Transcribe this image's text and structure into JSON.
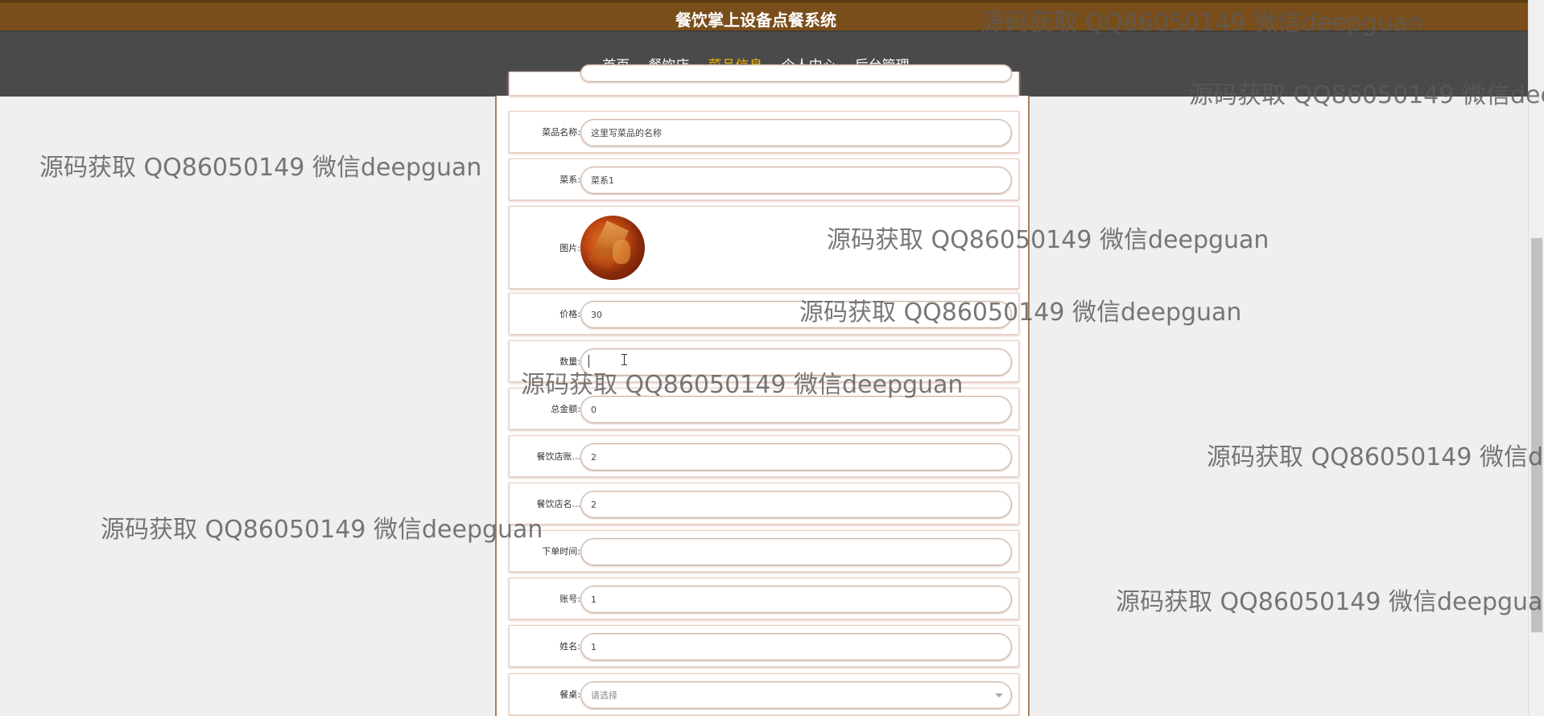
{
  "site": {
    "title": "餐饮掌上设备点餐系统"
  },
  "nav": {
    "items": [
      "首页",
      "餐饮店",
      "菜品信息",
      "个人中心",
      "后台管理"
    ],
    "active_index": 2
  },
  "form": {
    "dish_name": {
      "label": "菜品名称:",
      "value": "这里写菜品的名称"
    },
    "category": {
      "label": "菜系:",
      "value": "菜系1"
    },
    "image": {
      "label": "图片:"
    },
    "price": {
      "label": "价格:",
      "value": "30"
    },
    "quantity": {
      "label": "数量:",
      "value": ""
    },
    "total": {
      "label": "总金额:",
      "value": "0"
    },
    "restaurant_account": {
      "label": "餐饮店账...",
      "value": "2"
    },
    "restaurant_name": {
      "label": "餐饮店名...",
      "value": "2"
    },
    "order_time": {
      "label": "下单时间:",
      "value": ""
    },
    "account": {
      "label": "账号:",
      "value": "1"
    },
    "name": {
      "label": "姓名:",
      "value": "1"
    },
    "table": {
      "label": "餐桌:",
      "placeholder": "请选择"
    }
  },
  "watermark": {
    "text": "源码获取 QQ86050149 微信deepguan"
  },
  "colors": {
    "topbar": "#7a4e1a",
    "navbar": "#4a4a4a",
    "active_nav": "#f0b400"
  }
}
